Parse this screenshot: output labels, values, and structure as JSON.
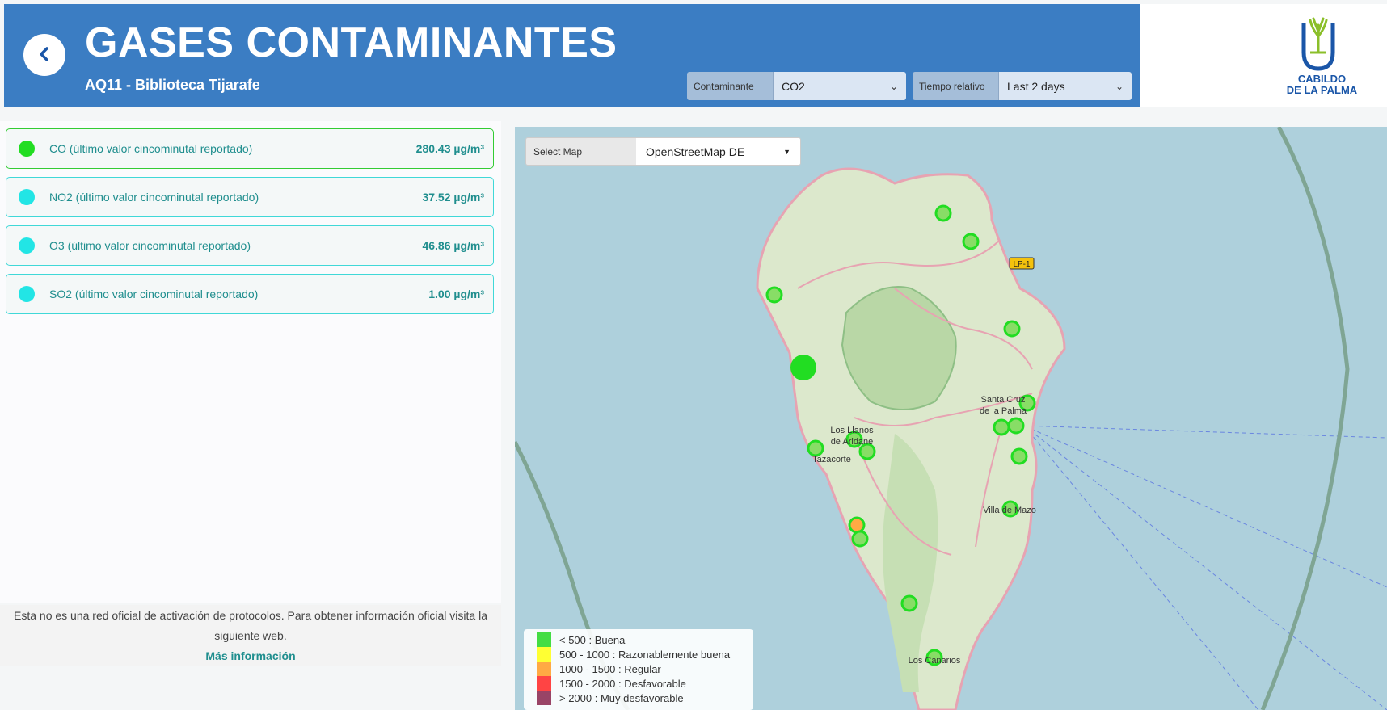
{
  "header": {
    "title": "GASES CONTAMINANTES",
    "subtitle": "AQ11 - Biblioteca Tijarafe",
    "back_icon": "chevron-left-icon",
    "contaminante_label": "Contaminante",
    "contaminante_value": "CO2",
    "tiempo_label": "Tiempo relativo",
    "tiempo_value": "Last 2 days",
    "logo_line1": "CABILDO",
    "logo_line2": "DE LA PALMA"
  },
  "gases": [
    {
      "name": "CO (último valor cincominutal reportado)",
      "value": "280.43 µg/m³",
      "color": "#22dd22"
    },
    {
      "name": "NO2 (último valor cincominutal reportado)",
      "value": "37.52 µg/m³",
      "color": "#22e5e5"
    },
    {
      "name": "O3 (último valor cincominutal reportado)",
      "value": "46.86 µg/m³",
      "color": "#22e5e5"
    },
    {
      "name": "SO2 (último valor cincominutal reportado)",
      "value": "1.00 µg/m³",
      "color": "#22e5e5"
    }
  ],
  "footer": {
    "note": "Esta no es una red oficial de activación de protocolos. Para obtener información oficial visita la siguiente web.",
    "link": "Más información"
  },
  "map": {
    "select_label": "Select Map",
    "select_value": "OpenStreetMap DE",
    "places": [
      "Santa Cruz de la Palma",
      "Los Llanos de Aridane",
      "Tazacorte",
      "Villa de Mazo",
      "Los Canarios",
      "LP-1"
    ],
    "legend": [
      {
        "label": "< 500 : Buena",
        "color": "#44dd44"
      },
      {
        "label": "500 - 1000 : Razonablemente buena",
        "color": "#ffff33"
      },
      {
        "label": "1000 - 1500 : Regular",
        "color": "#ffaa44"
      },
      {
        "label": "1500 - 2000 : Desfavorable",
        "color": "#ff4444"
      },
      {
        "label": "> 2000 : Muy desfavorable",
        "color": "#994466"
      }
    ]
  }
}
